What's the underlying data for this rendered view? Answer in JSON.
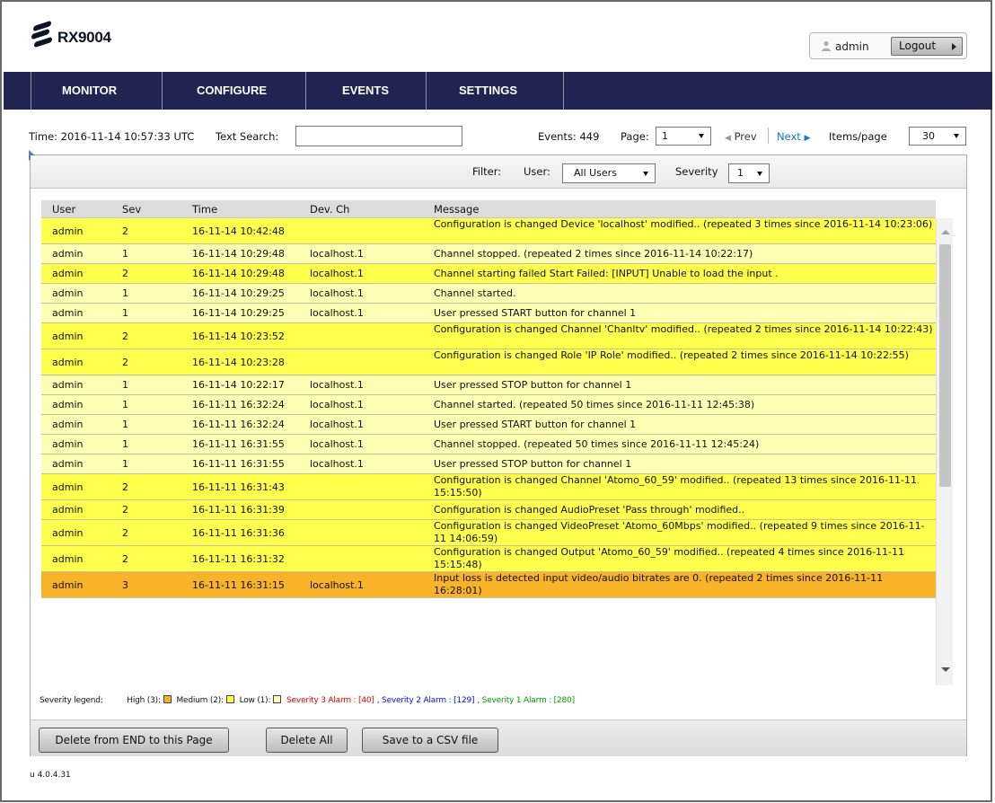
{
  "header": {
    "product_name": "RX9004",
    "user_name": "admin",
    "logout_label": "Logout"
  },
  "nav": {
    "items": [
      {
        "label": "MONITOR"
      },
      {
        "label": "CONFIGURE"
      },
      {
        "label": "EVENTS"
      },
      {
        "label": "SETTINGS"
      }
    ]
  },
  "toolbar": {
    "time_text": "Time: 2016-11-14 10:57:33 UTC",
    "search_label": "Text Search:",
    "search_value": "",
    "events_text": "Events: 449",
    "page_label": "Page:",
    "page_value": "1",
    "prev_label": "Prev",
    "next_label": "Next",
    "items_label": "Items/page",
    "items_value": "30"
  },
  "filter": {
    "label": "Filter:",
    "user_label": "User:",
    "user_value": "All Users",
    "severity_label": "Severity",
    "severity_value": "1"
  },
  "table": {
    "columns": [
      "User",
      "Sev",
      "Time",
      "Dev. Ch",
      "Message"
    ],
    "rows": [
      {
        "user": "admin",
        "sev": "2",
        "time": "16-11-14 10:42:48",
        "dev": "",
        "msg": "Configuration is changed Device 'localhost' modified.. (repeated 3 times since 2016-11-14 10:23:06)"
      },
      {
        "user": "admin",
        "sev": "1",
        "time": "16-11-14 10:29:48",
        "dev": "localhost.1",
        "msg": "Channel stopped. (repeated 2 times since 2016-11-14 10:22:17)"
      },
      {
        "user": "admin",
        "sev": "2",
        "time": "16-11-14 10:29:48",
        "dev": "localhost.1",
        "msg": "Channel starting failed Start Failed: [INPUT] Unable to load the input ."
      },
      {
        "user": "admin",
        "sev": "1",
        "time": "16-11-14 10:29:25",
        "dev": "localhost.1",
        "msg": "Channel started."
      },
      {
        "user": "admin",
        "sev": "1",
        "time": "16-11-14 10:29:25",
        "dev": "localhost.1",
        "msg": "User pressed START button for channel 1"
      },
      {
        "user": "admin",
        "sev": "2",
        "time": "16-11-14 10:23:52",
        "dev": "",
        "msg": "Configuration is changed Channel 'Chanltv' modified.. (repeated 2 times since 2016-11-14 10:22:43)"
      },
      {
        "user": "admin",
        "sev": "2",
        "time": "16-11-14 10:23:28",
        "dev": "",
        "msg": "Configuration is changed Role 'IP Role' modified.. (repeated 2 times since 2016-11-14 10:22:55)"
      },
      {
        "user": "admin",
        "sev": "1",
        "time": "16-11-14 10:22:17",
        "dev": "localhost.1",
        "msg": "User pressed STOP button for channel 1"
      },
      {
        "user": "admin",
        "sev": "1",
        "time": "16-11-11 16:32:24",
        "dev": "localhost.1",
        "msg": "Channel started. (repeated 50 times since 2016-11-11 12:45:38)"
      },
      {
        "user": "admin",
        "sev": "1",
        "time": "16-11-11 16:32:24",
        "dev": "localhost.1",
        "msg": "User pressed START button for channel 1"
      },
      {
        "user": "admin",
        "sev": "1",
        "time": "16-11-11 16:31:55",
        "dev": "localhost.1",
        "msg": "Channel stopped. (repeated 50 times since 2016-11-11 12:45:24)"
      },
      {
        "user": "admin",
        "sev": "1",
        "time": "16-11-11 16:31:55",
        "dev": "localhost.1",
        "msg": "User pressed STOP button for channel 1"
      },
      {
        "user": "admin",
        "sev": "2",
        "time": "16-11-11 16:31:43",
        "dev": "",
        "msg": "Configuration is changed Channel 'Atomo_60_59' modified.. (repeated 13 times since 2016-11-11 15:15:50)"
      },
      {
        "user": "admin",
        "sev": "2",
        "time": "16-11-11 16:31:39",
        "dev": "",
        "msg": "Configuration is changed AudioPreset 'Pass through' modified.."
      },
      {
        "user": "admin",
        "sev": "2",
        "time": "16-11-11 16:31:36",
        "dev": "",
        "msg": "Configuration is changed VideoPreset 'Atomo_60Mbps' modified.. (repeated 9 times since 2016-11-11 14:06:59)"
      },
      {
        "user": "admin",
        "sev": "2",
        "time": "16-11-11 16:31:32",
        "dev": "",
        "msg": "Configuration is changed Output 'Atomo_60_59' modified.. (repeated 4 times since 2016-11-11 15:15:48)"
      },
      {
        "user": "admin",
        "sev": "3",
        "time": "16-11-11 16:31:15",
        "dev": "localhost.1",
        "msg": "Input loss is detected input video/audio bitrates are 0. (repeated 2 times since 2016-11-11 16:28:01)"
      }
    ]
  },
  "legend": {
    "title": "Severity legend:",
    "high": "High (3):",
    "medium": "Medium (2):",
    "low": "Low (1):",
    "sev3": "Severity 3 Alarm : [40]",
    "sev2": ", Severity 2 Alarm : [129]",
    "sev1": ", Severity 1 Alarm : [280]",
    "colors": {
      "high": "#f8b328",
      "medium": "#ffff4d",
      "low": "#ffffb3"
    }
  },
  "actions": {
    "delete_from_end": "Delete from END to this Page",
    "delete_all": "Delete All",
    "save_csv": "Save to a CSV file"
  },
  "footer": {
    "version": "u 4.0.4.31"
  },
  "icons": [
    "ericsson-logo-icon",
    "user-icon",
    "logout-arrow-icon",
    "dropdown-arrow-icon",
    "prev-arrow-icon",
    "next-arrow-icon",
    "scroll-up-icon",
    "scroll-down-icon"
  ]
}
